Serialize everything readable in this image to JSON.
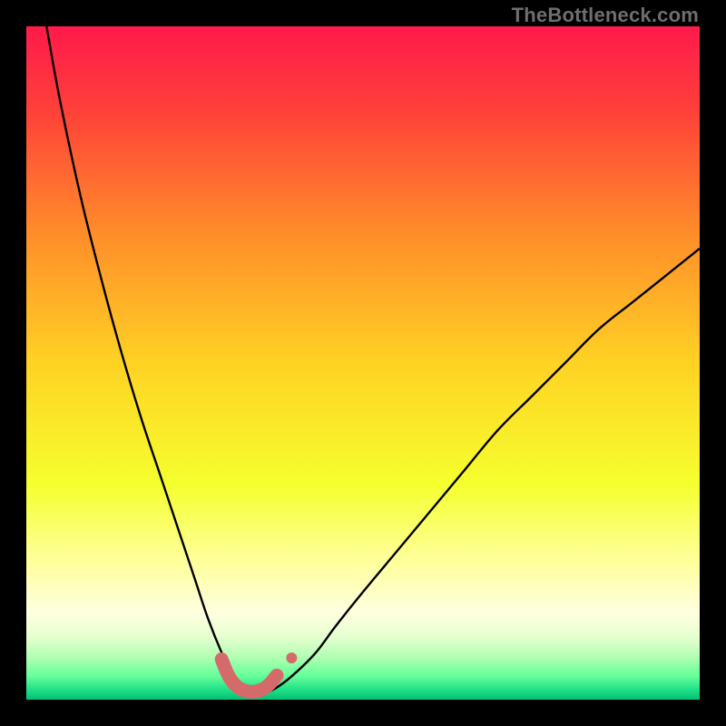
{
  "watermark": "TheBottleneck.com",
  "chart_data": {
    "type": "line",
    "title": "",
    "xlabel": "",
    "ylabel": "",
    "xlim": [
      0,
      100
    ],
    "ylim": [
      0,
      100
    ],
    "background_gradient": {
      "stops": [
        {
          "offset": 0.0,
          "color": "#ff1a4b"
        },
        {
          "offset": 0.12,
          "color": "#ff3e3a"
        },
        {
          "offset": 0.3,
          "color": "#ff8a2a"
        },
        {
          "offset": 0.5,
          "color": "#ffd224"
        },
        {
          "offset": 0.68,
          "color": "#f5ff2e"
        },
        {
          "offset": 0.8,
          "color": "#ffffa0"
        },
        {
          "offset": 0.87,
          "color": "#ffffe0"
        },
        {
          "offset": 0.905,
          "color": "#e8ffd0"
        },
        {
          "offset": 0.935,
          "color": "#b4ffb4"
        },
        {
          "offset": 0.965,
          "color": "#66ff99"
        },
        {
          "offset": 0.985,
          "color": "#20e088"
        },
        {
          "offset": 1.0,
          "color": "#00c074"
        }
      ]
    },
    "series": [
      {
        "name": "bottleneck-curve",
        "type": "line",
        "color": "#000000",
        "width": 2.4,
        "x": [
          3,
          5,
          8,
          11,
          14,
          17,
          20,
          23,
          25,
          27,
          29,
          30.5,
          32,
          33,
          34,
          35.5,
          37.5,
          40,
          43,
          46,
          50,
          55,
          60,
          65,
          70,
          75,
          80,
          85,
          90,
          95,
          100
        ],
        "values": [
          100,
          89,
          75,
          63,
          52,
          42,
          33,
          24,
          18,
          12,
          7,
          4,
          2,
          1,
          1,
          1,
          2,
          4,
          7,
          11,
          16,
          22,
          28,
          34,
          40,
          45,
          50,
          55,
          59,
          63,
          67
        ]
      },
      {
        "name": "optimal-range-highlight",
        "type": "line",
        "color": "#d56a6a",
        "width": 15,
        "linecap": "round",
        "x": [
          29.0,
          30.0,
          31.0,
          32.0,
          33.0,
          34.0,
          35.0,
          36.0,
          37.2
        ],
        "values": [
          6.0,
          3.6,
          2.2,
          1.5,
          1.2,
          1.2,
          1.5,
          2.2,
          3.6
        ]
      },
      {
        "name": "highlight-dot",
        "type": "scatter",
        "color": "#d56a6a",
        "radius": 6,
        "x": [
          39.4
        ],
        "values": [
          6.2
        ]
      }
    ]
  }
}
